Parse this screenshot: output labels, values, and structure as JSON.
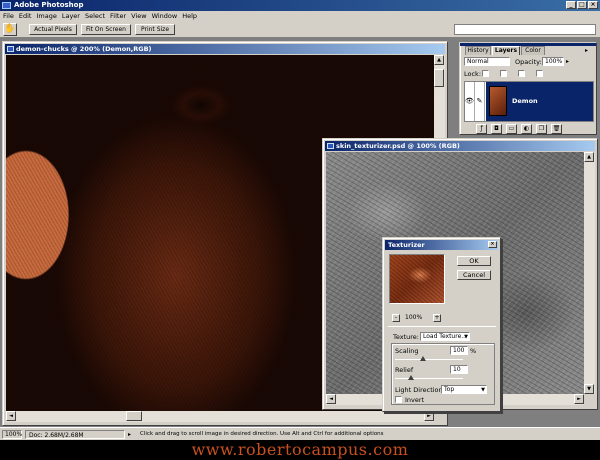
{
  "app": {
    "title": "Adobe Photoshop",
    "menu": [
      "File",
      "Edit",
      "Image",
      "Layer",
      "Select",
      "Filter",
      "View",
      "Window",
      "Help"
    ]
  },
  "options_bar": {
    "buttons": [
      "Actual Pixels",
      "Fit On Screen",
      "Print Size"
    ]
  },
  "windows": {
    "demon": {
      "title": "demon-chucks @ 200% (Demon,RGB)"
    },
    "skin": {
      "title": "skin_texturizer.psd @ 100% (RGB)"
    }
  },
  "layers_palette": {
    "tabs": [
      "History",
      "Layers",
      "Color"
    ],
    "blend_mode": "Normal",
    "opacity_label": "Opacity:",
    "opacity_value": "100%",
    "lock_label": "Lock:",
    "layer_name": "Demon"
  },
  "texturizer": {
    "title": "Texturizer",
    "ok": "OK",
    "cancel": "Cancel",
    "zoom_minus": "-",
    "zoom_value": "100%",
    "zoom_plus": "+",
    "texture_label": "Texture:",
    "texture_value": "Load Texture...",
    "scaling_label": "Scaling",
    "scaling_value": "100",
    "scaling_unit": "%",
    "relief_label": "Relief",
    "relief_value": "10",
    "light_label": "Light Direction:",
    "light_value": "Top",
    "invert_label": "Invert"
  },
  "status": {
    "zoom": "100%",
    "doc": "Doc: 2.68M/2.68M",
    "hint": "Click and drag to scroll image in desired direction.  Use Alt and Ctrl for additional options"
  },
  "footer": {
    "url": "www.robertocampus.com"
  },
  "colors": {
    "title_start": "#0a246a",
    "title_end": "#a6caf0",
    "layer_selected": "#0a246a",
    "footer_text": "#c8501e"
  }
}
